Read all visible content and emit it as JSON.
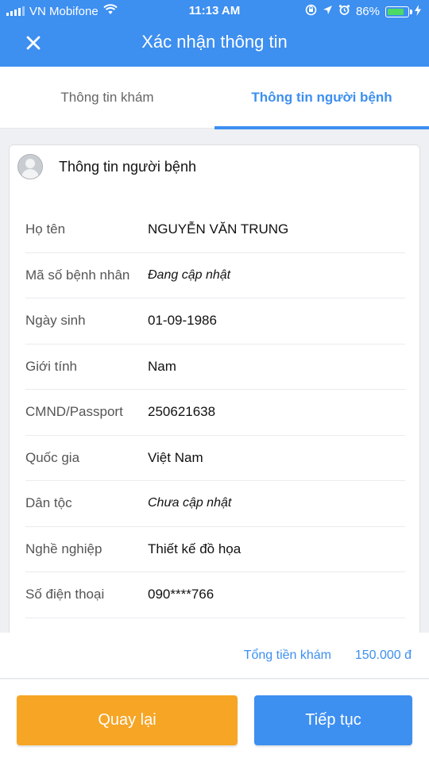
{
  "status_bar": {
    "carrier": "VN Mobifone",
    "time": "11:13 AM",
    "battery_percent": "86%",
    "battery_level": 0.86
  },
  "header": {
    "title": "Xác nhận thông tin",
    "close_icon": "close-icon"
  },
  "tabs": [
    {
      "label": "Thông tin khám",
      "active": false
    },
    {
      "label": "Thông tin người bệnh",
      "active": true
    }
  ],
  "card": {
    "title": "Thông tin người bệnh",
    "rows": [
      {
        "label": "Họ tên",
        "value": "NGUYỄN VĂN TRUNG"
      },
      {
        "label": "Mã số bệnh nhân",
        "value": "Đang cập nhật"
      },
      {
        "label": "Ngày sinh",
        "value": "01-09-1986"
      },
      {
        "label": "Giới tính",
        "value": "Nam"
      },
      {
        "label": "CMND/Passport",
        "value": "250621638"
      },
      {
        "label": "Quốc gia",
        "value": "Việt Nam"
      },
      {
        "label": "Dân tộc",
        "value": "Chưa cập nhật"
      },
      {
        "label": "Nghề nghiệp",
        "value": "Thiết kế đồ họa"
      },
      {
        "label": "Số điện thoại",
        "value": "090****766"
      }
    ]
  },
  "summary": {
    "total_label": "Tổng tiền khám",
    "total_value": "150.000 đ"
  },
  "footer": {
    "back_label": "Quay lại",
    "next_label": "Tiếp tục"
  },
  "colors": {
    "primary": "#3d8ff0",
    "back_button": "#f6a524",
    "battery_fill": "#4cd964"
  }
}
